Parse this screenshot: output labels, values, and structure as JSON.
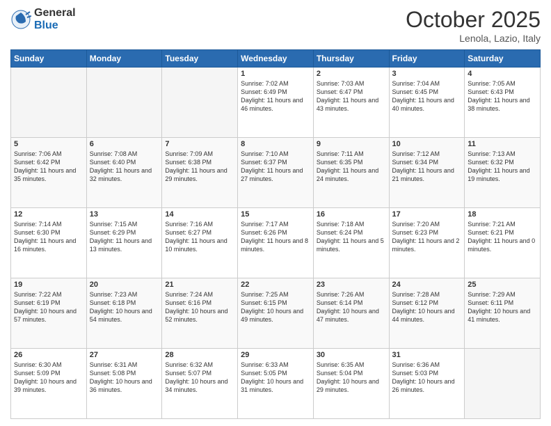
{
  "logo": {
    "general": "General",
    "blue": "Blue"
  },
  "header": {
    "month": "October 2025",
    "location": "Lenola, Lazio, Italy"
  },
  "days_of_week": [
    "Sunday",
    "Monday",
    "Tuesday",
    "Wednesday",
    "Thursday",
    "Friday",
    "Saturday"
  ],
  "weeks": [
    [
      {
        "day": "",
        "text": ""
      },
      {
        "day": "",
        "text": ""
      },
      {
        "day": "",
        "text": ""
      },
      {
        "day": "1",
        "text": "Sunrise: 7:02 AM\nSunset: 6:49 PM\nDaylight: 11 hours\nand 46 minutes."
      },
      {
        "day": "2",
        "text": "Sunrise: 7:03 AM\nSunset: 6:47 PM\nDaylight: 11 hours\nand 43 minutes."
      },
      {
        "day": "3",
        "text": "Sunrise: 7:04 AM\nSunset: 6:45 PM\nDaylight: 11 hours\nand 40 minutes."
      },
      {
        "day": "4",
        "text": "Sunrise: 7:05 AM\nSunset: 6:43 PM\nDaylight: 11 hours\nand 38 minutes."
      }
    ],
    [
      {
        "day": "5",
        "text": "Sunrise: 7:06 AM\nSunset: 6:42 PM\nDaylight: 11 hours\nand 35 minutes."
      },
      {
        "day": "6",
        "text": "Sunrise: 7:08 AM\nSunset: 6:40 PM\nDaylight: 11 hours\nand 32 minutes."
      },
      {
        "day": "7",
        "text": "Sunrise: 7:09 AM\nSunset: 6:38 PM\nDaylight: 11 hours\nand 29 minutes."
      },
      {
        "day": "8",
        "text": "Sunrise: 7:10 AM\nSunset: 6:37 PM\nDaylight: 11 hours\nand 27 minutes."
      },
      {
        "day": "9",
        "text": "Sunrise: 7:11 AM\nSunset: 6:35 PM\nDaylight: 11 hours\nand 24 minutes."
      },
      {
        "day": "10",
        "text": "Sunrise: 7:12 AM\nSunset: 6:34 PM\nDaylight: 11 hours\nand 21 minutes."
      },
      {
        "day": "11",
        "text": "Sunrise: 7:13 AM\nSunset: 6:32 PM\nDaylight: 11 hours\nand 19 minutes."
      }
    ],
    [
      {
        "day": "12",
        "text": "Sunrise: 7:14 AM\nSunset: 6:30 PM\nDaylight: 11 hours\nand 16 minutes."
      },
      {
        "day": "13",
        "text": "Sunrise: 7:15 AM\nSunset: 6:29 PM\nDaylight: 11 hours\nand 13 minutes."
      },
      {
        "day": "14",
        "text": "Sunrise: 7:16 AM\nSunset: 6:27 PM\nDaylight: 11 hours\nand 10 minutes."
      },
      {
        "day": "15",
        "text": "Sunrise: 7:17 AM\nSunset: 6:26 PM\nDaylight: 11 hours\nand 8 minutes."
      },
      {
        "day": "16",
        "text": "Sunrise: 7:18 AM\nSunset: 6:24 PM\nDaylight: 11 hours\nand 5 minutes."
      },
      {
        "day": "17",
        "text": "Sunrise: 7:20 AM\nSunset: 6:23 PM\nDaylight: 11 hours\nand 2 minutes."
      },
      {
        "day": "18",
        "text": "Sunrise: 7:21 AM\nSunset: 6:21 PM\nDaylight: 11 hours\nand 0 minutes."
      }
    ],
    [
      {
        "day": "19",
        "text": "Sunrise: 7:22 AM\nSunset: 6:19 PM\nDaylight: 10 hours\nand 57 minutes."
      },
      {
        "day": "20",
        "text": "Sunrise: 7:23 AM\nSunset: 6:18 PM\nDaylight: 10 hours\nand 54 minutes."
      },
      {
        "day": "21",
        "text": "Sunrise: 7:24 AM\nSunset: 6:16 PM\nDaylight: 10 hours\nand 52 minutes."
      },
      {
        "day": "22",
        "text": "Sunrise: 7:25 AM\nSunset: 6:15 PM\nDaylight: 10 hours\nand 49 minutes."
      },
      {
        "day": "23",
        "text": "Sunrise: 7:26 AM\nSunset: 6:14 PM\nDaylight: 10 hours\nand 47 minutes."
      },
      {
        "day": "24",
        "text": "Sunrise: 7:28 AM\nSunset: 6:12 PM\nDaylight: 10 hours\nand 44 minutes."
      },
      {
        "day": "25",
        "text": "Sunrise: 7:29 AM\nSunset: 6:11 PM\nDaylight: 10 hours\nand 41 minutes."
      }
    ],
    [
      {
        "day": "26",
        "text": "Sunrise: 6:30 AM\nSunset: 5:09 PM\nDaylight: 10 hours\nand 39 minutes."
      },
      {
        "day": "27",
        "text": "Sunrise: 6:31 AM\nSunset: 5:08 PM\nDaylight: 10 hours\nand 36 minutes."
      },
      {
        "day": "28",
        "text": "Sunrise: 6:32 AM\nSunset: 5:07 PM\nDaylight: 10 hours\nand 34 minutes."
      },
      {
        "day": "29",
        "text": "Sunrise: 6:33 AM\nSunset: 5:05 PM\nDaylight: 10 hours\nand 31 minutes."
      },
      {
        "day": "30",
        "text": "Sunrise: 6:35 AM\nSunset: 5:04 PM\nDaylight: 10 hours\nand 29 minutes."
      },
      {
        "day": "31",
        "text": "Sunrise: 6:36 AM\nSunset: 5:03 PM\nDaylight: 10 hours\nand 26 minutes."
      },
      {
        "day": "",
        "text": ""
      }
    ]
  ]
}
